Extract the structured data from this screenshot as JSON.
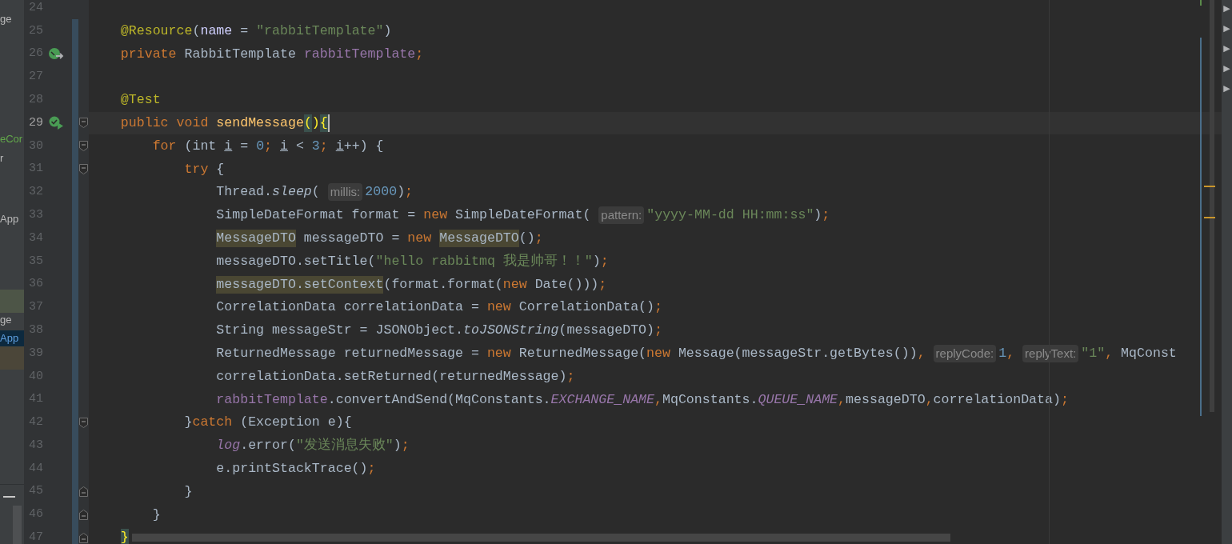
{
  "sidebar": {
    "rows": [
      {
        "text": "ge",
        "kind": "plain",
        "selected": false
      },
      {
        "text": "eCor",
        "kind": "green",
        "selected": false
      },
      {
        "text": "r",
        "kind": "plain",
        "selected": false
      },
      {
        "text": "App",
        "kind": "plain",
        "selected": false
      },
      {
        "kind": "band-green",
        "selected": false
      },
      {
        "text": "ge",
        "kind": "plain",
        "selected": false
      },
      {
        "text": "App",
        "kind": "blue",
        "selected": true
      },
      {
        "kind": "band-brown",
        "selected": false
      }
    ]
  },
  "editor": {
    "lines": [
      {
        "number": "24",
        "changed": false,
        "current": false
      },
      {
        "number": "25",
        "changed": true,
        "current": false,
        "tokens": [
          {
            "kind": "ann",
            "text": "@Resource"
          },
          {
            "kind": "p",
            "text": "("
          },
          {
            "kind": "attr",
            "text": "name"
          },
          {
            "kind": "p",
            "text": " = "
          },
          {
            "kind": "s",
            "text": "\"rabbitTemplate\""
          },
          {
            "kind": "p",
            "text": ")"
          }
        ]
      },
      {
        "number": "26",
        "changed": true,
        "current": false,
        "gutter_icon": {
          "kind": "implements"
        },
        "tokens": [
          {
            "kind": "kw",
            "text": "private"
          },
          {
            "kind": "p",
            "text": " RabbitTemplate "
          },
          {
            "kind": "f",
            "text": "rabbitTemplate"
          },
          {
            "kind": "kw",
            "text": ";"
          }
        ]
      },
      {
        "number": "27",
        "changed": true,
        "current": false
      },
      {
        "number": "28",
        "changed": true,
        "current": false,
        "tokens": [
          {
            "kind": "ann",
            "text": "@Test"
          }
        ]
      },
      {
        "number": "29",
        "changed": true,
        "current": true,
        "gutter_icon": {
          "kind": "run"
        },
        "fold": {
          "kind": "open"
        },
        "tokens": [
          {
            "kind": "kw",
            "text": "public void "
          },
          {
            "kind": "d",
            "text": "sendMessage"
          },
          {
            "kind": "bm",
            "text": "("
          },
          {
            "kind": "y",
            "text": ")"
          },
          {
            "kind": "bm",
            "text": "{",
            "caret": true
          }
        ],
        "children": [
          {
            "number": "30",
            "changed": true,
            "current": false,
            "fold": {
              "kind": "open"
            },
            "tokens": [
              {
                "kind": "kw",
                "text": "for"
              },
              {
                "kind": "p",
                "text": " (int "
              },
              {
                "kind": "u",
                "text": "i"
              },
              {
                "kind": "p",
                "text": " = "
              },
              {
                "kind": "n",
                "text": "0"
              },
              {
                "kind": "kw",
                "text": "; "
              },
              {
                "kind": "u",
                "text": "i"
              },
              {
                "kind": "p",
                "text": " < "
              },
              {
                "kind": "n",
                "text": "3"
              },
              {
                "kind": "kw",
                "text": "; "
              },
              {
                "kind": "u",
                "text": "i"
              },
              {
                "kind": "p",
                "text": "++) {"
              }
            ],
            "children": [
              {
                "number": "31",
                "changed": true,
                "current": false,
                "fold": {
                  "kind": "open"
                },
                "tokens": [
                  {
                    "kind": "kw",
                    "text": "try"
                  },
                  {
                    "kind": "p",
                    "text": " {"
                  }
                ],
                "children": [
                  {
                    "number": "32",
                    "changed": true,
                    "current": false,
                    "tokens": [
                      {
                        "kind": "p",
                        "text": "Thread."
                      },
                      {
                        "kind": "mi",
                        "text": "sleep"
                      },
                      {
                        "kind": "p",
                        "text": "("
                      },
                      {
                        "kind": "h",
                        "text": "millis:"
                      },
                      {
                        "kind": "n",
                        "text": "2000"
                      },
                      {
                        "kind": "p",
                        "text": ")"
                      },
                      {
                        "kind": "kw",
                        "text": ";"
                      }
                    ]
                  },
                  {
                    "number": "33",
                    "changed": true,
                    "current": false,
                    "tokens": [
                      {
                        "kind": "p",
                        "text": "SimpleDateFormat format = "
                      },
                      {
                        "kind": "kw",
                        "text": "new"
                      },
                      {
                        "kind": "p",
                        "text": " SimpleDateFormat("
                      },
                      {
                        "kind": "h",
                        "text": "pattern:"
                      },
                      {
                        "kind": "s",
                        "text": "\"yyyy-MM-dd HH:mm:ss\""
                      },
                      {
                        "kind": "p",
                        "text": ")"
                      },
                      {
                        "kind": "kw",
                        "text": ";"
                      }
                    ]
                  },
                  {
                    "number": "34",
                    "changed": true,
                    "current": false,
                    "tokens": [
                      {
                        "kind": "hl",
                        "text": "MessageDTO"
                      },
                      {
                        "kind": "p",
                        "text": " messageDTO = "
                      },
                      {
                        "kind": "kw",
                        "text": "new "
                      },
                      {
                        "kind": "hl",
                        "text": "MessageDTO"
                      },
                      {
                        "kind": "p",
                        "text": "()"
                      },
                      {
                        "kind": "kw",
                        "text": ";"
                      }
                    ]
                  },
                  {
                    "number": "35",
                    "changed": true,
                    "current": false,
                    "tokens": [
                      {
                        "kind": "p",
                        "text": "messageDTO.setTitle("
                      },
                      {
                        "kind": "s",
                        "text": "\"hello rabbitmq 我是帅哥！！\""
                      },
                      {
                        "kind": "p",
                        "text": ")"
                      },
                      {
                        "kind": "kw",
                        "text": ";"
                      }
                    ]
                  },
                  {
                    "number": "36",
                    "changed": true,
                    "current": false,
                    "tokens": [
                      {
                        "kind": "hl",
                        "text": "messageDTO.setContext"
                      },
                      {
                        "kind": "p",
                        "text": "(format.format("
                      },
                      {
                        "kind": "kw",
                        "text": "new"
                      },
                      {
                        "kind": "p",
                        "text": " Date()))"
                      },
                      {
                        "kind": "kw",
                        "text": ";"
                      }
                    ]
                  },
                  {
                    "number": "37",
                    "changed": true,
                    "current": false,
                    "tokens": [
                      {
                        "kind": "p",
                        "text": "CorrelationData correlationData = "
                      },
                      {
                        "kind": "kw",
                        "text": "new"
                      },
                      {
                        "kind": "p",
                        "text": " CorrelationData()"
                      },
                      {
                        "kind": "kw",
                        "text": ";"
                      }
                    ]
                  },
                  {
                    "number": "38",
                    "changed": true,
                    "current": false,
                    "tokens": [
                      {
                        "kind": "p",
                        "text": "String messageStr = JSONObject."
                      },
                      {
                        "kind": "mi",
                        "text": "toJSONString"
                      },
                      {
                        "kind": "p",
                        "text": "(messageDTO)"
                      },
                      {
                        "kind": "kw",
                        "text": ";"
                      }
                    ]
                  },
                  {
                    "number": "39",
                    "changed": true,
                    "current": false,
                    "tokens": [
                      {
                        "kind": "p",
                        "text": "ReturnedMessage returnedMessage = "
                      },
                      {
                        "kind": "kw",
                        "text": "new"
                      },
                      {
                        "kind": "p",
                        "text": " ReturnedMessage("
                      },
                      {
                        "kind": "kw",
                        "text": "new"
                      },
                      {
                        "kind": "p",
                        "text": " Message(messageStr.getBytes())"
                      },
                      {
                        "kind": "kw",
                        "text": ","
                      },
                      {
                        "kind": "h",
                        "text": "replyCode:"
                      },
                      {
                        "kind": "n",
                        "text": "1"
                      },
                      {
                        "kind": "kw",
                        "text": ","
                      },
                      {
                        "kind": "h",
                        "text": "replyText:"
                      },
                      {
                        "kind": "s",
                        "text": "\"1\""
                      },
                      {
                        "kind": "kw",
                        "text": ","
                      },
                      {
                        "kind": "p",
                        "text": " MqConst"
                      }
                    ]
                  },
                  {
                    "number": "40",
                    "changed": true,
                    "current": false,
                    "tokens": [
                      {
                        "kind": "p",
                        "text": "correlationData.setReturned(returnedMessage)"
                      },
                      {
                        "kind": "kw",
                        "text": ";"
                      }
                    ]
                  },
                  {
                    "number": "41",
                    "changed": true,
                    "current": false,
                    "tokens": [
                      {
                        "kind": "f",
                        "text": "rabbitTemplate"
                      },
                      {
                        "kind": "p",
                        "text": ".convertAndSend(MqConstants."
                      },
                      {
                        "kind": "fi",
                        "text": "EXCHANGE_NAME"
                      },
                      {
                        "kind": "kw",
                        "text": ","
                      },
                      {
                        "kind": "p",
                        "text": "MqConstants."
                      },
                      {
                        "kind": "fi",
                        "text": "QUEUE_NAME"
                      },
                      {
                        "kind": "kw",
                        "text": ","
                      },
                      {
                        "kind": "p",
                        "text": "messageDTO"
                      },
                      {
                        "kind": "kw",
                        "text": ","
                      },
                      {
                        "kind": "p",
                        "text": "correlationData)"
                      },
                      {
                        "kind": "kw",
                        "text": ";"
                      }
                    ]
                  }
                ]
              },
              {
                "number": "42",
                "changed": true,
                "current": false,
                "fold": {
                  "kind": "open"
                },
                "tokens": [
                  {
                    "kind": "p",
                    "text": "}"
                  },
                  {
                    "kind": "kw",
                    "text": "catch"
                  },
                  {
                    "kind": "p",
                    "text": " (Exception e){"
                  }
                ],
                "children": [
                  {
                    "number": "43",
                    "changed": true,
                    "current": false,
                    "tokens": [
                      {
                        "kind": "fi",
                        "text": "log"
                      },
                      {
                        "kind": "p",
                        "text": ".error("
                      },
                      {
                        "kind": "s",
                        "text": "\"发送消息失败\""
                      },
                      {
                        "kind": "p",
                        "text": ")"
                      },
                      {
                        "kind": "kw",
                        "text": ";"
                      }
                    ]
                  },
                  {
                    "number": "44",
                    "changed": true,
                    "current": false,
                    "tokens": [
                      {
                        "kind": "p",
                        "text": "e.printStackTrace()"
                      },
                      {
                        "kind": "kw",
                        "text": ";"
                      }
                    ]
                  }
                ]
              },
              {
                "number": "45",
                "changed": true,
                "current": false,
                "fold": {
                  "kind": "close"
                },
                "tokens": [
                  {
                    "kind": "p",
                    "text": "}"
                  }
                ]
              }
            ]
          },
          {
            "number": "46",
            "changed": true,
            "current": false,
            "fold": {
              "kind": "close"
            },
            "tokens": [
              {
                "kind": "p",
                "text": "}"
              }
            ]
          }
        ]
      },
      {
        "number": "47",
        "changed": true,
        "current": false,
        "fold": {
          "kind": "close"
        },
        "tokens": [
          {
            "kind": "bm",
            "text": "}"
          }
        ]
      }
    ]
  },
  "right_strip": {
    "arrows": [
      "▶",
      "▶",
      "▶",
      "▶",
      "▶"
    ]
  }
}
